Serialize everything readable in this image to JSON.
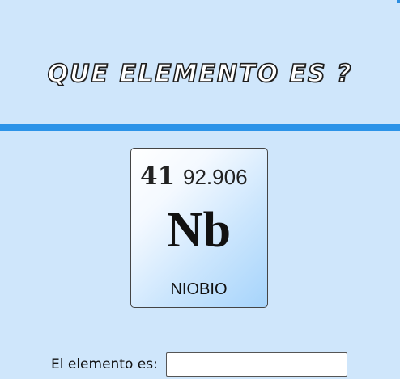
{
  "header": {
    "title": "QUE ELEMENTO ES ?"
  },
  "element": {
    "atomic_number": "41",
    "atomic_mass": "92.906",
    "symbol": "Nb",
    "name": "NIOBIO"
  },
  "answer": {
    "label": "El elemento es:",
    "value": ""
  },
  "colors": {
    "background": "#cfe6fb",
    "divider": "#2c93e8"
  }
}
